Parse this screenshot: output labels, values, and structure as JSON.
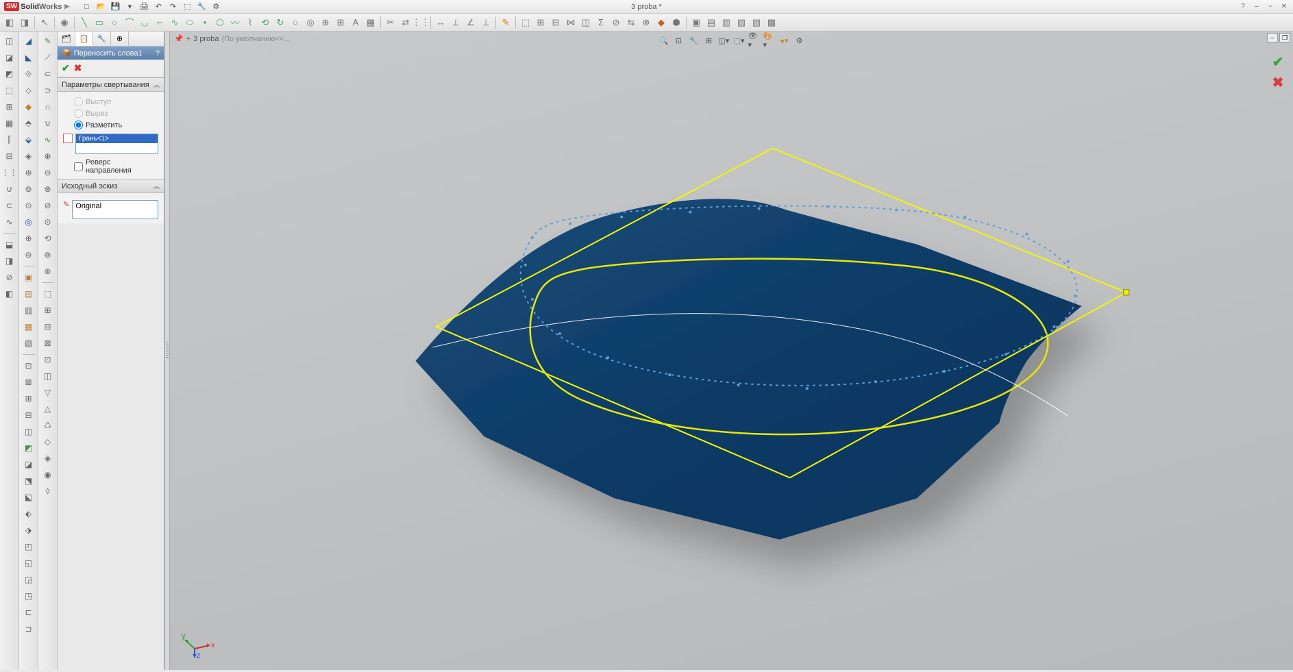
{
  "app": {
    "name_bold": "Solid",
    "name_light": "Works"
  },
  "document": {
    "title": "3 proba *"
  },
  "breadcrumb": {
    "doc": "3 proba",
    "config": "(По умолчанию<<..."
  },
  "propmgr": {
    "feature_title": "Переносить слова1",
    "section_wrap": "Параметры свертывания",
    "radio_boss": "Выступ",
    "radio_cut": "Вырез",
    "radio_scribe": "Разметить",
    "face_item": "Грань<1>",
    "reverse_label": "Реверс направления",
    "section_source": "Исходный эскиз",
    "source_value": "Original"
  },
  "triad": {
    "x": "x",
    "y": "y",
    "z": "z"
  }
}
